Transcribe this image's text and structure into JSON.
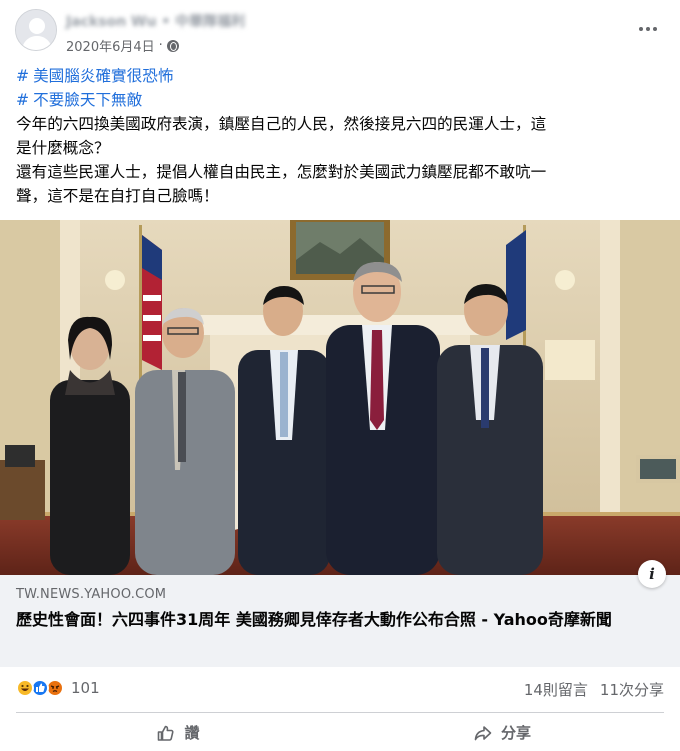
{
  "post": {
    "author_name": "Jackson Wu • 中華隊福利",
    "date": "2020年6月4日",
    "separator": "·",
    "hashtags": [
      {
        "hash": "#",
        "text": "美國腦炎確實很恐怖"
      },
      {
        "hash": "#",
        "text": "不要臉天下無敵"
      }
    ],
    "body_lines": [
      "今年的六四換美國政府表演，鎮壓自己的人民，然後接見六四的民運人士，這",
      "是什麼概念？",
      "還有這些民運人士，提倡人權自由民主，怎麼對於美國武力鎮壓屁都不敢吭一",
      "聲，這不是在自打自己臉嗎！"
    ]
  },
  "link": {
    "domain": "TW.NEWS.YAHOO.COM",
    "title": "歷史性會面！六四事件31周年 美國務卿見倖存者大動作公布合照 - Yahoo奇摩新聞",
    "info_glyph": "i"
  },
  "stats": {
    "reaction_count": "101",
    "reactions": [
      "haha",
      "like",
      "angry"
    ],
    "comments": "14則留言",
    "shares": "11次分享"
  },
  "actions": {
    "like_label": "讚",
    "share_label": "分享"
  },
  "colors": {
    "hashtag": "#216fdb",
    "secondary_text": "#65676b",
    "link_card_bg": "#f0f2f5",
    "like_blue": "#1877f2",
    "haha_yellow": "#f7b928",
    "angry_orange": "#e9710f"
  }
}
